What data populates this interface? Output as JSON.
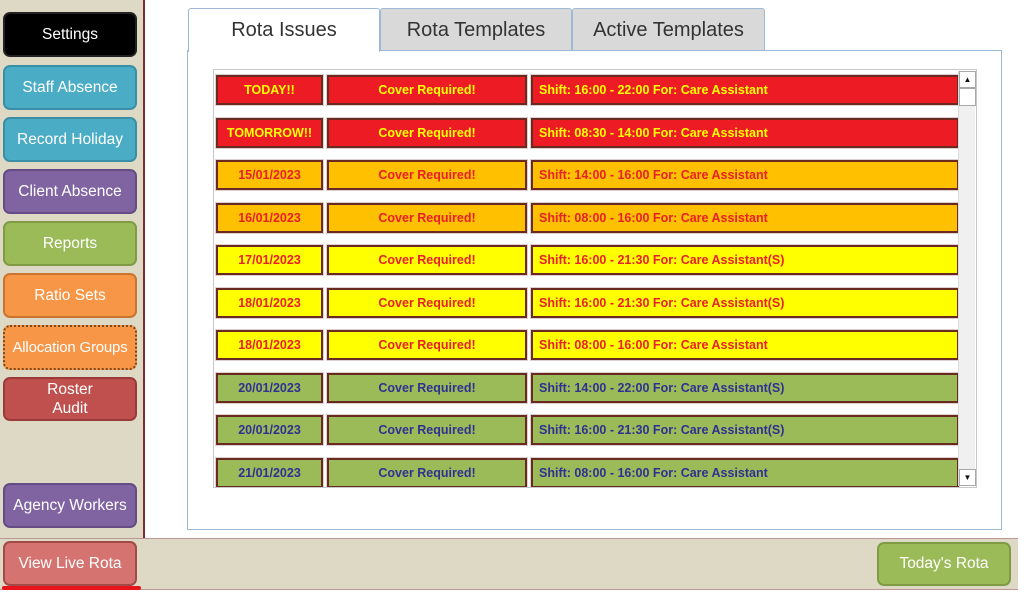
{
  "sidebar": {
    "buttons": [
      {
        "label": "Settings",
        "color": "#000000"
      },
      {
        "label": "Staff Absence",
        "color": "#4bacc6"
      },
      {
        "label": "Record Holiday",
        "color": "#4bacc6"
      },
      {
        "label": "Client Absence",
        "color": "#8064a2"
      },
      {
        "label": "Reports",
        "color": "#9bbb59"
      },
      {
        "label": "Ratio Sets",
        "color": "#f79646"
      },
      {
        "label": "Allocation Groups",
        "color": "#f79646"
      },
      {
        "label": "Roster\nAudit",
        "color": "#c0504d"
      },
      {
        "label": "Agency Workers",
        "color": "#8064a2"
      }
    ]
  },
  "bottombar": {
    "view_live_rota": "View Live Rota",
    "todays_rota": "Today's Rota"
  },
  "tabs": [
    {
      "label": "Rota Issues",
      "active": true
    },
    {
      "label": "Rota Templates",
      "active": false
    },
    {
      "label": "Active Templates",
      "active": false
    }
  ],
  "issue_colors": {
    "red": {
      "bg": "#ed1c24",
      "text": "#ffff00"
    },
    "orange": {
      "bg": "#ffc000",
      "text": "#e8202a"
    },
    "yellow": {
      "bg": "#ffff00",
      "text": "#e8202a"
    },
    "green": {
      "bg": "#9bbb59",
      "text": "#2e3192"
    }
  },
  "issues": [
    {
      "date": "TODAY!!",
      "status": "Cover Required!",
      "shift": "Shift: 16:00 - 22:00 For: Care Assistant",
      "level": "red"
    },
    {
      "date": "TOMORROW!!",
      "status": "Cover Required!",
      "shift": "Shift: 08:30 - 14:00 For: Care Assistant",
      "level": "red"
    },
    {
      "date": "15/01/2023",
      "status": "Cover Required!",
      "shift": "Shift: 14:00 - 16:00 For: Care Assistant",
      "level": "orange"
    },
    {
      "date": "16/01/2023",
      "status": "Cover Required!",
      "shift": "Shift: 08:00 - 16:00 For: Care Assistant",
      "level": "orange"
    },
    {
      "date": "17/01/2023",
      "status": "Cover Required!",
      "shift": "Shift: 16:00 - 21:30 For: Care Assistant(S)",
      "level": "yellow"
    },
    {
      "date": "18/01/2023",
      "status": "Cover Required!",
      "shift": "Shift: 16:00 - 21:30 For: Care Assistant(S)",
      "level": "yellow"
    },
    {
      "date": "18/01/2023",
      "status": "Cover Required!",
      "shift": "Shift: 08:00 - 16:00 For: Care Assistant",
      "level": "yellow"
    },
    {
      "date": "20/01/2023",
      "status": "Cover Required!",
      "shift": "Shift: 14:00 - 22:00 For: Care Assistant(S)",
      "level": "green"
    },
    {
      "date": "20/01/2023",
      "status": "Cover Required!",
      "shift": "Shift: 16:00 - 21:30 For: Care Assistant(S)",
      "level": "green"
    },
    {
      "date": "21/01/2023",
      "status": "Cover Required!",
      "shift": "Shift: 08:00 - 16:00 For: Care Assistant",
      "level": "green"
    }
  ],
  "scrollbar": {
    "up_icon": "▲",
    "down_icon": "▼"
  }
}
